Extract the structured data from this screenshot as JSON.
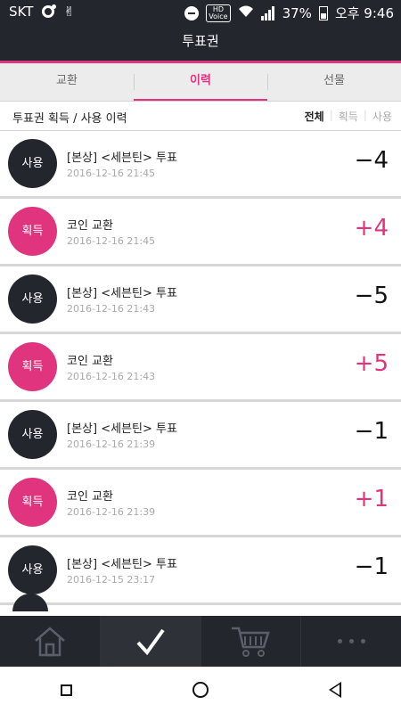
{
  "status_bar": {
    "carrier": "SKT",
    "battery": "37%",
    "time": "오후 9:46",
    "hd_label": "HD\nVoice"
  },
  "header": {
    "title": "투표권"
  },
  "tabs": [
    {
      "label": "교환",
      "active": false
    },
    {
      "label": "이력",
      "active": true
    },
    {
      "label": "선물",
      "active": false
    }
  ],
  "subheader": {
    "title": "투표권 획득 / 사용 이력",
    "filters": [
      "전체",
      "획득",
      "사용"
    ],
    "active_filter": "전체"
  },
  "history": [
    {
      "badge": "사용",
      "type": "use",
      "title": "[본상] <세븐틴> 투표",
      "date": "2016-12-16 21:45",
      "amount": "−4"
    },
    {
      "badge": "획득",
      "type": "get",
      "title": "코인 교환",
      "date": "2016-12-16 21:45",
      "amount": "+4"
    },
    {
      "badge": "사용",
      "type": "use",
      "title": "[본상] <세븐틴> 투표",
      "date": "2016-12-16 21:43",
      "amount": "−5"
    },
    {
      "badge": "획득",
      "type": "get",
      "title": "코인 교환",
      "date": "2016-12-16 21:43",
      "amount": "+5"
    },
    {
      "badge": "사용",
      "type": "use",
      "title": "[본상] <세븐틴> 투표",
      "date": "2016-12-16 21:39",
      "amount": "−1"
    },
    {
      "badge": "획득",
      "type": "get",
      "title": "코인 교환",
      "date": "2016-12-16 21:39",
      "amount": "+1"
    },
    {
      "badge": "사용",
      "type": "use",
      "title": "[본상] <세븐틴> 투표",
      "date": "2016-12-15 23:17",
      "amount": "−1"
    }
  ],
  "bottom_nav": [
    {
      "icon": "home-icon",
      "active": false
    },
    {
      "icon": "check-icon",
      "active": true
    },
    {
      "icon": "cart-icon",
      "active": false
    },
    {
      "icon": "more-icon",
      "active": false
    }
  ],
  "colors": {
    "accent": "#e0347e",
    "dark": "#23262d"
  }
}
